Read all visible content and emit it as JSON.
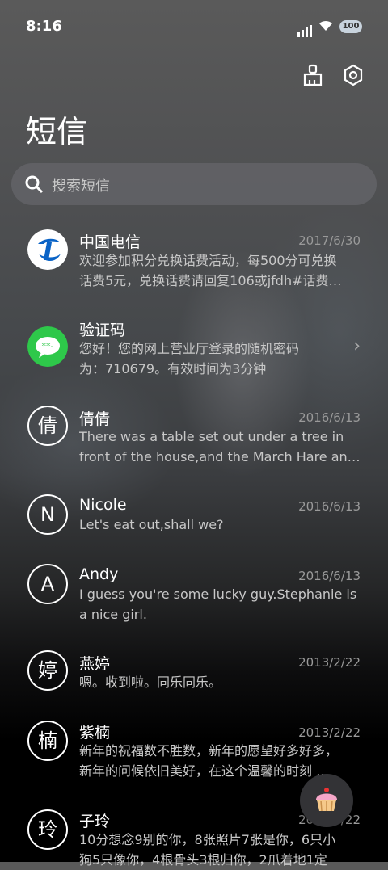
{
  "status": {
    "time": "8:16",
    "battery": "100"
  },
  "header": {
    "title": "短信"
  },
  "search": {
    "placeholder": "搜索短信"
  },
  "icons": {
    "clean": "broom-icon",
    "settings": "settings-gear-icon",
    "fab": "cupcake-icon"
  },
  "conversations": [
    {
      "name": "中国电信",
      "date": "2017/6/30",
      "line1": "欢迎参加积分兑换话费活动，每500分可兑换",
      "line2": "话费5元，兑换话费请回复106或jfdh#话费…",
      "avatar": "telecom-logo"
    },
    {
      "name": "验证码",
      "date": "",
      "line1": "您好！您的网上营业厅登录的随机密码",
      "line2": "为：710679。有效时间为3分钟",
      "avatar": "message-bubble-icon"
    },
    {
      "name": "倩倩",
      "date": "2016/6/13",
      "line1": "There was a table set out under a tree in",
      "line2": "front of the house,and the March Hare an…",
      "initial": "倩"
    },
    {
      "name": "Nicole",
      "date": "2016/6/13",
      "line1": "Let's eat out,shall we?",
      "line2": "",
      "initial": "N"
    },
    {
      "name": "Andy",
      "date": "2016/6/13",
      "line1": "I guess you're some lucky guy.Stephanie is",
      "line2": "a nice girl.",
      "initial": "A"
    },
    {
      "name": "燕婷",
      "date": "2013/2/22",
      "line1": "嗯。收到啦。同乐同乐。",
      "line2": "",
      "initial": "婷"
    },
    {
      "name": "紫楠",
      "date": "2013/2/22",
      "line1": "新年的祝福数不胜数，新年的愿望好多好多，",
      "line2": "新年的问候依旧美好，在这个温馨的时刻 …",
      "initial": "楠"
    },
    {
      "name": "子玲",
      "date": "2013/2/22",
      "line1": "10分想念9别的你，8张照片7张是你，6只小",
      "line2": "狗5只像你，4根骨头3根归你，2爪着地1定",
      "initial": "玲"
    }
  ]
}
